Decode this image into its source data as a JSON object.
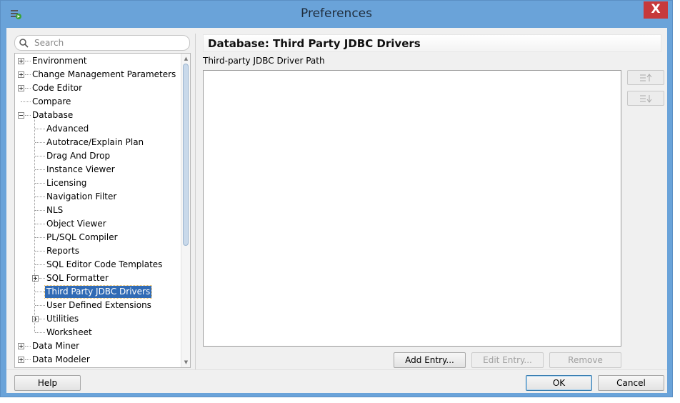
{
  "window": {
    "title": "Preferences",
    "close_label": "X"
  },
  "search": {
    "placeholder": "Search",
    "value": ""
  },
  "tree": {
    "items": [
      {
        "label": "Environment",
        "level": 0,
        "expander": "plus"
      },
      {
        "label": "Change Management Parameters",
        "level": 0,
        "expander": "plus"
      },
      {
        "label": "Code Editor",
        "level": 0,
        "expander": "plus"
      },
      {
        "label": "Compare",
        "level": 0,
        "expander": "none"
      },
      {
        "label": "Database",
        "level": 0,
        "expander": "minus"
      },
      {
        "label": "Advanced",
        "level": 1,
        "expander": "none"
      },
      {
        "label": "Autotrace/Explain Plan",
        "level": 1,
        "expander": "none"
      },
      {
        "label": "Drag And Drop",
        "level": 1,
        "expander": "none"
      },
      {
        "label": "Instance Viewer",
        "level": 1,
        "expander": "none"
      },
      {
        "label": "Licensing",
        "level": 1,
        "expander": "none"
      },
      {
        "label": "Navigation Filter",
        "level": 1,
        "expander": "none"
      },
      {
        "label": "NLS",
        "level": 1,
        "expander": "none"
      },
      {
        "label": "Object Viewer",
        "level": 1,
        "expander": "none"
      },
      {
        "label": "PL/SQL Compiler",
        "level": 1,
        "expander": "none"
      },
      {
        "label": "Reports",
        "level": 1,
        "expander": "none"
      },
      {
        "label": "SQL Editor Code Templates",
        "level": 1,
        "expander": "none"
      },
      {
        "label": "SQL Formatter",
        "level": 1,
        "expander": "plus"
      },
      {
        "label": "Third Party JDBC Drivers",
        "level": 1,
        "expander": "none",
        "selected": true
      },
      {
        "label": "User Defined Extensions",
        "level": 1,
        "expander": "none"
      },
      {
        "label": "Utilities",
        "level": 1,
        "expander": "plus"
      },
      {
        "label": "Worksheet",
        "level": 1,
        "expander": "none"
      },
      {
        "label": "Data Miner",
        "level": 0,
        "expander": "plus"
      },
      {
        "label": "Data Modeler",
        "level": 0,
        "expander": "plus"
      }
    ]
  },
  "page": {
    "header": "Database: Third Party JDBC Drivers",
    "path_label": "Third-party JDBC Driver Path",
    "move_up_icon": "move-up-icon",
    "move_down_icon": "move-down-icon"
  },
  "buttons": {
    "add_entry": "Add Entry...",
    "edit_entry": "Edit Entry...",
    "remove": "Remove",
    "help": "Help",
    "ok": "OK",
    "cancel": "Cancel"
  },
  "colors": {
    "titlebar": "#6aa3d9",
    "close": "#c7393b",
    "selection": "#316bb5"
  }
}
